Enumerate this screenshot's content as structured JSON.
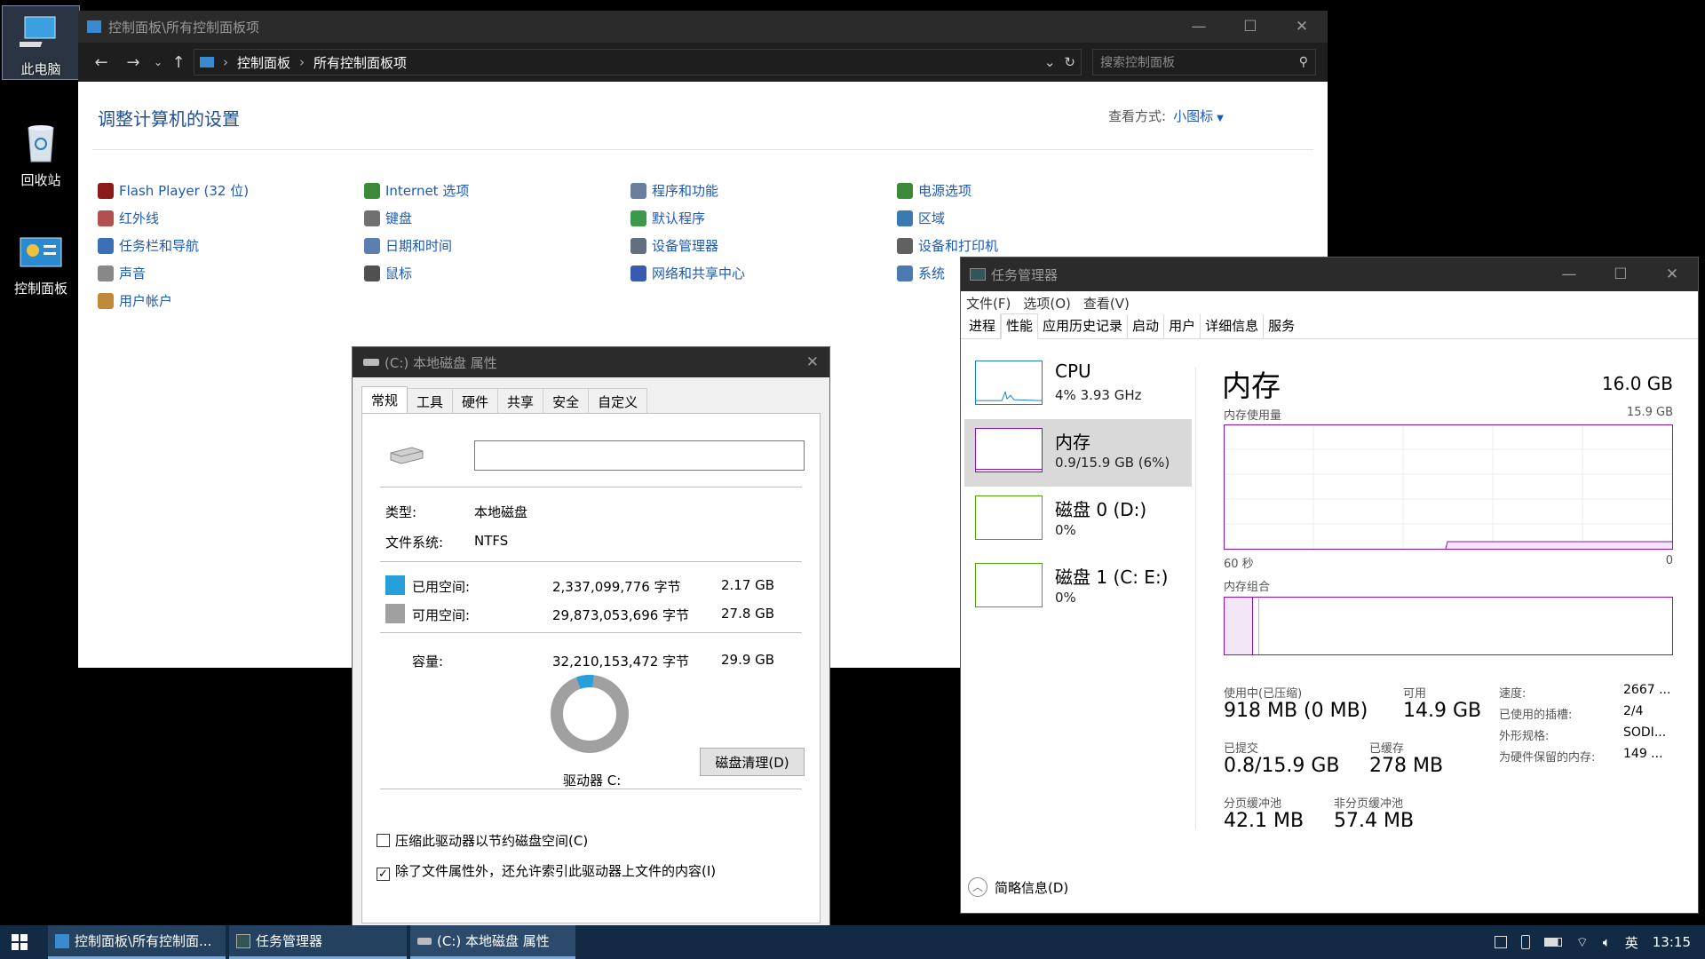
{
  "desktop": {
    "icons": [
      {
        "label": "此电脑"
      },
      {
        "label": "回收站"
      },
      {
        "label": "控制面板"
      }
    ]
  },
  "control_panel": {
    "title": "控制面板\\所有控制面板项",
    "breadcrumb": [
      "控制面板",
      "所有控制面板项"
    ],
    "search_placeholder": "搜索控制面板",
    "heading": "调整计算机的设置",
    "view_by_label": "查看方式:",
    "view_by_value": "小图标",
    "items": [
      {
        "label": "Flash Player (32 位)",
        "icon": "flash-icon",
        "color": "#8b1a1a"
      },
      {
        "label": "红外线",
        "icon": "infrared-icon",
        "color": "#b05050"
      },
      {
        "label": "任务栏和导航",
        "icon": "taskbar-icon",
        "color": "#3b6fb6"
      },
      {
        "label": "声音",
        "icon": "sound-icon",
        "color": "#888888"
      },
      {
        "label": "用户帐户",
        "icon": "user-accounts-icon",
        "color": "#c08a3a"
      },
      {
        "label": "Internet 选项",
        "icon": "internet-icon",
        "color": "#3a8a3a"
      },
      {
        "label": "键盘",
        "icon": "keyboard-icon",
        "color": "#707070"
      },
      {
        "label": "日期和时间",
        "icon": "clock-icon",
        "color": "#5a7fb0"
      },
      {
        "label": "鼠标",
        "icon": "mouse-icon",
        "color": "#505050"
      },
      {
        "label": "程序和功能",
        "icon": "programs-icon",
        "color": "#6a7fa0"
      },
      {
        "label": "默认程序",
        "icon": "default-programs-icon",
        "color": "#3a9a4a"
      },
      {
        "label": "设备管理器",
        "icon": "device-manager-icon",
        "color": "#607080"
      },
      {
        "label": "网络和共享中心",
        "icon": "network-icon",
        "color": "#3a5ab0"
      },
      {
        "label": "电源选项",
        "icon": "power-icon",
        "color": "#3a8a3a"
      },
      {
        "label": "区域",
        "icon": "region-icon",
        "color": "#3a7ab0"
      },
      {
        "label": "设备和打印机",
        "icon": "printer-icon",
        "color": "#606060"
      },
      {
        "label": "系统",
        "icon": "system-icon",
        "color": "#4a7ab0"
      }
    ]
  },
  "disk_props": {
    "title": "(C:) 本地磁盘 属性",
    "tabs": [
      "常规",
      "工具",
      "硬件",
      "共享",
      "安全",
      "自定义"
    ],
    "type_label": "类型:",
    "type_value": "本地磁盘",
    "fs_label": "文件系统:",
    "fs_value": "NTFS",
    "used_label": "已用空间:",
    "used_bytes": "2,337,099,776 字节",
    "used_gb": "2.17 GB",
    "used_color": "#26a0da",
    "free_label": "可用空间:",
    "free_bytes": "29,873,053,696 字节",
    "free_gb": "27.8 GB",
    "free_color": "#a0a0a0",
    "cap_label": "容量:",
    "cap_bytes": "32,210,153,472 字节",
    "cap_gb": "29.9 GB",
    "used_fraction": 0.0726,
    "drive_label": "驱动器 C:",
    "cleanup_button": "磁盘清理(D)",
    "compress_label": "压缩此驱动器以节约磁盘空间(C)",
    "index_label": "除了文件属性外，还允许索引此驱动器上文件的内容(I)"
  },
  "task_manager": {
    "title": "任务管理器",
    "menu": [
      "文件(F)",
      "选项(O)",
      "查看(V)"
    ],
    "tabs": [
      "进程",
      "性能",
      "应用历史记录",
      "启动",
      "用户",
      "详细信息",
      "服务"
    ],
    "side": [
      {
        "name": "CPU",
        "value": "4% 3.93 GHz"
      },
      {
        "name": "内存",
        "value": "0.9/15.9 GB (6%)"
      },
      {
        "name": "磁盘 0 (D:)",
        "value": "0%"
      },
      {
        "name": "磁盘 1 (C: E:)",
        "value": "0%"
      }
    ],
    "heading": "内存",
    "total": "16.0 GB",
    "usage_label": "内存使用量",
    "usage_max": "15.9 GB",
    "time_left": "60 秒",
    "time_right": "0",
    "composition_label": "内存组合",
    "in_use_label": "使用中(已压缩)",
    "in_use_value": "918 MB (0 MB)",
    "available_label": "可用",
    "available_value": "14.9 GB",
    "committed_label": "已提交",
    "committed_value": "0.8/15.9 GB",
    "cached_label": "已缓存",
    "cached_value": "278 MB",
    "paged_label": "分页缓冲池",
    "paged_value": "42.1 MB",
    "nonpaged_label": "非分页缓冲池",
    "nonpaged_value": "57.4 MB",
    "speed_label": "速度:",
    "speed_value": "2667 ...",
    "slots_label": "已使用的插槽:",
    "slots_value": "2/4",
    "form_label": "外形规格:",
    "form_value": "SODI...",
    "reserved_label": "为硬件保留的内存:",
    "reserved_value": "149 ...",
    "summary_label": "简略信息(D)"
  },
  "taskbar": {
    "items": [
      "控制面板\\所有控制面...",
      "任务管理器",
      "(C:) 本地磁盘 属性"
    ],
    "ime": "英",
    "time": "13:15"
  }
}
